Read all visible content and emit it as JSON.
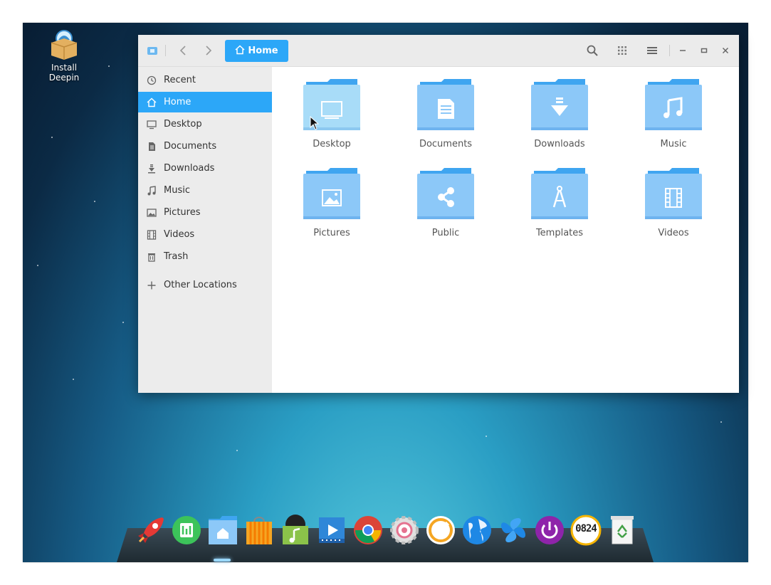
{
  "desktop": {
    "icons": [
      {
        "label": "Install Deepin",
        "icon": "installer-package-icon"
      }
    ]
  },
  "window": {
    "breadcrumb_label": "Home",
    "toolbar_icons": [
      "back-icon",
      "forward-icon",
      "search-icon",
      "grid-view-icon",
      "menu-icon",
      "minimize-icon",
      "maximize-icon",
      "close-icon"
    ]
  },
  "sidebar": {
    "items": [
      {
        "label": "Recent",
        "icon": "clock-icon"
      },
      {
        "label": "Home",
        "icon": "home-icon"
      },
      {
        "label": "Desktop",
        "icon": "monitor-icon"
      },
      {
        "label": "Documents",
        "icon": "document-icon"
      },
      {
        "label": "Downloads",
        "icon": "download-icon"
      },
      {
        "label": "Music",
        "icon": "music-note-icon"
      },
      {
        "label": "Pictures",
        "icon": "picture-icon"
      },
      {
        "label": "Videos",
        "icon": "film-icon"
      },
      {
        "label": "Trash",
        "icon": "trash-icon"
      },
      {
        "label": "Other Locations",
        "icon": "plus-icon"
      }
    ],
    "active_item": "Home"
  },
  "folders": [
    {
      "label": "Desktop",
      "icon": "monitor-icon"
    },
    {
      "label": "Documents",
      "icon": "document-icon"
    },
    {
      "label": "Downloads",
      "icon": "download-icon"
    },
    {
      "label": "Music",
      "icon": "music-note-icon"
    },
    {
      "label": "Pictures",
      "icon": "picture-icon"
    },
    {
      "label": "Public",
      "icon": "share-icon"
    },
    {
      "label": "Templates",
      "icon": "compass-icon"
    },
    {
      "label": "Videos",
      "icon": "film-icon"
    }
  ],
  "dock": {
    "apps": [
      "launcher-rocket-icon",
      "deepin-store-green-icon",
      "file-manager-icon",
      "app-store-bag-icon",
      "music-player-icon",
      "video-player-icon",
      "chrome-icon",
      "settings-gear-icon",
      "screenshot-icon",
      "browser-globe-icon",
      "remote-assist-icon",
      "shutdown-icon",
      "clock-icon",
      "trash-bin-icon"
    ],
    "clock_text": "0824"
  },
  "colors": {
    "accent": "#2ca7f8",
    "folder": "#8cc8f8",
    "folder_dark": "#3fa5f0"
  }
}
